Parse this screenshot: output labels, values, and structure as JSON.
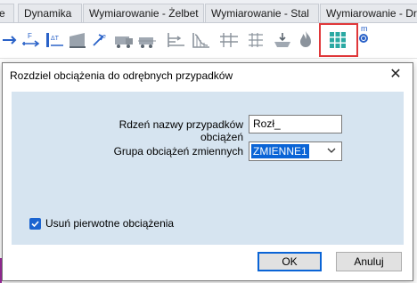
{
  "tabs": [
    "e",
    "Dynamika",
    "Wymiarowanie - Żelbet",
    "Wymiarowanie - Stal",
    "Wymiarowanie - Dr"
  ],
  "toolbar": {
    "icons": [
      "arrow-force-icon",
      "force-f-icon",
      "thermal-load-icon",
      "beam-load-icon",
      "moving-load-icon",
      "vehicle-icon",
      "snow-load-icon",
      "wind-load-icon",
      "tool-grid-icon",
      "settlement-icon",
      "fire-icon",
      "split-cases-icon"
    ],
    "m_label": "m"
  },
  "dialog": {
    "title": "Rozdziel obciążenia do odrębnych przypadków",
    "close_glyph": "✕",
    "case_name_label": "Rdzeń nazwy przypadków obciążeń",
    "case_name_value": "Rozł_",
    "group_label": "Grupa obciążeń zmiennych",
    "group_value": "ZMIENNE1",
    "remove_original_label": "Usuń pierwotne obciążenia",
    "remove_original_checked": true,
    "ok_label": "OK",
    "cancel_label": "Anuluj"
  },
  "colors": {
    "panel_bg": "#d6e4f0",
    "highlight_border": "#e0383a",
    "accent": "#0a64d6"
  }
}
